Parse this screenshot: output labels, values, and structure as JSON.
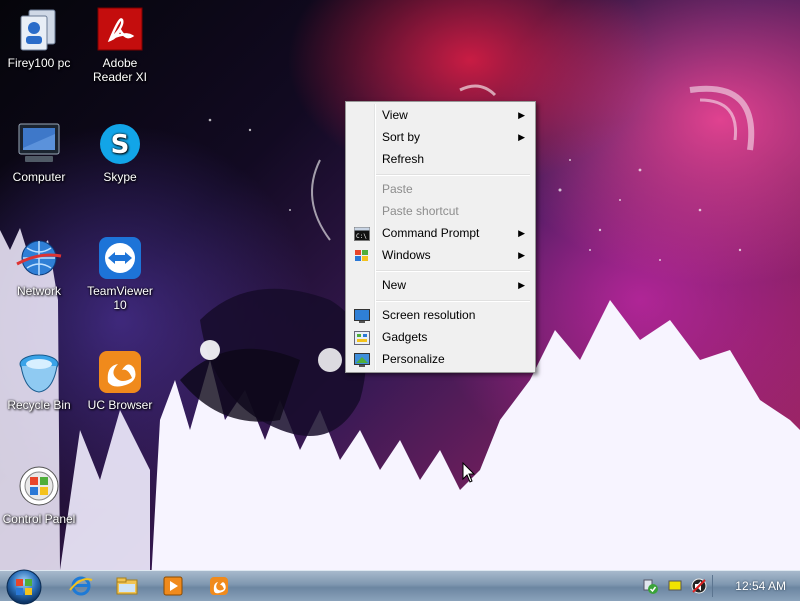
{
  "desktop": {
    "icons": [
      {
        "label": "Firey100 pc",
        "icon": "user-folder-icon"
      },
      {
        "label": "Adobe Reader XI",
        "icon": "adobe-reader-icon"
      },
      {
        "label": "Computer",
        "icon": "computer-icon"
      },
      {
        "label": "Skype",
        "icon": "skype-icon"
      },
      {
        "label": "Network",
        "icon": "network-icon"
      },
      {
        "label": "TeamViewer 10",
        "icon": "teamviewer-icon"
      },
      {
        "label": "Recycle Bin",
        "icon": "recycle-bin-icon"
      },
      {
        "label": "UC Browser",
        "icon": "uc-browser-icon"
      },
      {
        "label": "Control Panel",
        "icon": "control-panel-icon"
      }
    ]
  },
  "context_menu": {
    "view": "View",
    "sort_by": "Sort by",
    "refresh": "Refresh",
    "paste": "Paste",
    "paste_shortcut": "Paste shortcut",
    "command_prompt": "Command Prompt",
    "windows": "Windows",
    "new": "New",
    "screen_resolution": "Screen resolution",
    "gadgets": "Gadgets",
    "personalize": "Personalize"
  },
  "taskbar": {
    "start": "start-orb-icon",
    "pinned": [
      "internet-explorer-icon",
      "file-explorer-icon",
      "media-player-icon",
      "uc-browser-icon"
    ],
    "tray": [
      "action-center-icon",
      "flag-icon",
      "volume-icon"
    ],
    "clock": "12:54 AM"
  }
}
